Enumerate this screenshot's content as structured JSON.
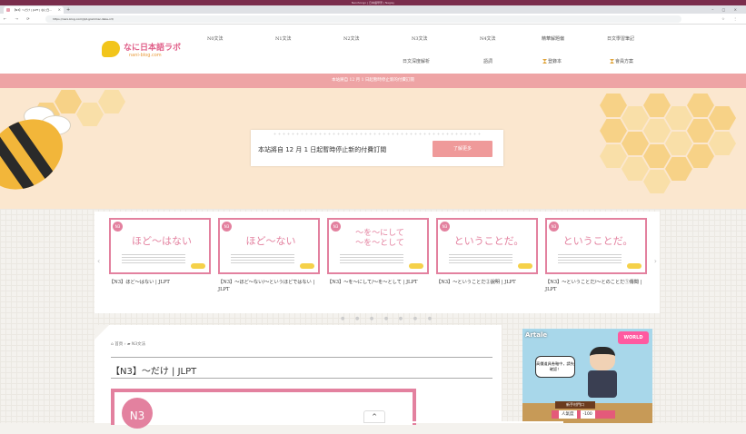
{
  "browser": {
    "window_title": "Nanihongo | 日本語學習 | Nagisy",
    "tab_title": "【N3】〜だけ | JLPT | なに日...",
    "url": "https://nani-blog.com/jlpt-grammar-dake-n3/"
  },
  "site": {
    "logo_title": "なに日本語ラボ",
    "logo_subtitle": "nani-blog.com",
    "nav_row1": [
      "N0文法",
      "N1文法",
      "N2文法",
      "N3文法",
      "N4文法",
      "精華解題偏",
      "日文學習筆記"
    ],
    "nav_row2": [
      "日文深度解析",
      "語詞",
      "登錄本",
      "會員方案"
    ],
    "announcement_bar": "本站將自 12 月 1 日起暫時停止新的付費訂閱"
  },
  "hero": {
    "notice_text": "本站將自 12 月 1 日起暫時停止新的付費訂閱",
    "notice_button": "了解更多"
  },
  "carousel": {
    "prev_arrow": "‹",
    "next_arrow": "›",
    "cards": [
      {
        "level": "N3",
        "big": "ほど〜はない",
        "caption": "【N3】ほど〜はない | JLPT"
      },
      {
        "level": "N3",
        "big": "ほど〜ない",
        "caption": "【N3】〜ほど〜ない/〜というほどではない | JLPT"
      },
      {
        "level": "N3",
        "big": "〜を〜にして\n〜を〜として",
        "caption": "【N3】〜を〜にして/〜を〜として | JLPT"
      },
      {
        "level": "N3",
        "big": "ということだ。",
        "caption": "【N3】〜ということだ②說明 | JLPT"
      },
      {
        "level": "N3",
        "big": "ということだ。",
        "caption": "【N3】〜ということだ/〜とのことだ①傳聞 | JLPT"
      }
    ],
    "dots": "● ● ● ● ● ● ●"
  },
  "article": {
    "breadcrumb_home": "首頁",
    "breadcrumb_category": "N3文法",
    "title": "【N3】〜だけ | JLPT",
    "image_level": "N3"
  },
  "ad": {
    "brand": "Artale",
    "badge": "WORLD",
    "bubble": "高價道具卷軸中，請先確認！",
    "tag": "新手村門口",
    "bar_label": "人氣度",
    "bar_value": "-100"
  },
  "scroll_top": "^"
}
